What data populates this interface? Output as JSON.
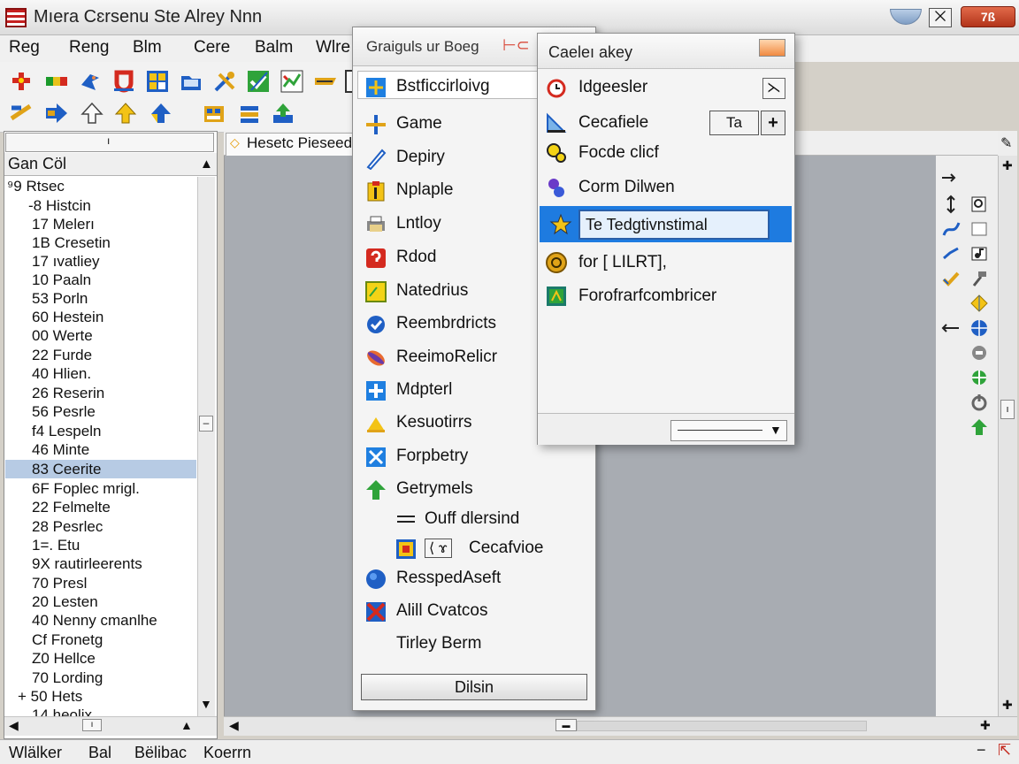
{
  "window": {
    "title": "Mıera Cɛrsenu Ste Alrey Nnn",
    "close_label": "7ß",
    "max_glyph": "⨉"
  },
  "menubar": [
    "Reg",
    "Reng",
    "Blm",
    "Cere",
    "Balm",
    "Wlre"
  ],
  "left_pane": {
    "top_mark": "ı",
    "header": "Gan Cöl",
    "root": "⁹9 Rtsec",
    "items": [
      "-8 Histcin",
      "17 Melerı",
      "1B Cresetin",
      "17 ıvatliey",
      "10 Paaln",
      "53 Porln",
      "60 Hestein",
      "00 Werte",
      "22 Furde",
      "40 Hlien.",
      "26 Reserin",
      "56 Pesrle",
      "f4 Lespeln",
      "46 Minte",
      "83 Ceerite",
      "6F Foplec mrigl.",
      "22 Felmelte",
      "28 Pesrlec",
      "1=. Etu",
      "9X rautirleerents",
      "70 Presl",
      "20 Lesten",
      "40 Nenny cmanlhe",
      "Cf Fronetg",
      "Z0 Hellce",
      "70 Lording",
      "+ 50 Hets",
      "14 heolix"
    ],
    "selected_index": 14
  },
  "document": {
    "tab_label": "Hesetc Pieseed"
  },
  "menu1": {
    "title": "Graiguls ur Boeg",
    "title_glyph": "⊢⊂",
    "highlight": "Bstficcirloivg",
    "items": [
      {
        "icon": "plus-cross-icon",
        "label": "Game"
      },
      {
        "icon": "pen-icon",
        "label": "Depiry"
      },
      {
        "icon": "clipboard-icon",
        "label": "Nplaple"
      },
      {
        "icon": "printer-icon",
        "label": "Lntloy"
      },
      {
        "icon": "red-question-icon",
        "label": "Rdod"
      },
      {
        "icon": "yellow-note-icon",
        "label": "Natedrius"
      },
      {
        "icon": "blue-shield-icon",
        "label": "Reembrdricts"
      },
      {
        "icon": "capsule-icon",
        "label": "ReeimoRelicr"
      },
      {
        "icon": "blue-plus-icon",
        "label": "Mdpterl"
      },
      {
        "icon": "yellow-triangle-icon",
        "label": "Kesuotirrs"
      },
      {
        "icon": "blue-cross-icon",
        "label": "Forpbetry"
      },
      {
        "icon": "green-arrow-up-icon",
        "label": "Getrymels"
      },
      {
        "icon": "equals-icon",
        "label": "Ouff dlersind"
      },
      {
        "icon": "color-square-icon",
        "label": "Cecafvioe",
        "prefix": "⟨ ɤ"
      },
      {
        "icon": "blue-circle-icon",
        "label": "ResspedAseft"
      },
      {
        "icon": "flag-icon",
        "label": "Alill Cvatcos"
      },
      {
        "icon": "none",
        "label": "Tirley Berm"
      }
    ],
    "button_label": "Dilsin"
  },
  "menu2": {
    "title": "Caeleı akey",
    "items": [
      {
        "icon": "alarm-icon",
        "label": "Idgeesler"
      },
      {
        "icon": "blue-ruler-icon",
        "label": "Cecafiele"
      },
      {
        "icon": "yellow-link-icon",
        "label": "Focde clicf"
      },
      {
        "icon": "purple-key-icon",
        "label": "Corm Dilwen"
      },
      {
        "icon": "gold-coin-icon",
        "label": "for [ LILRT],"
      },
      {
        "icon": "green-frame-icon",
        "label": "Forofrarfcombricer"
      }
    ],
    "spin_value": "Ta",
    "spin_plus": "+",
    "close_glyph": "⋋",
    "selected": "Te Tedgtivnstimal"
  },
  "statusbar": [
    "Wlälker",
    "Bal",
    "Bëlibac",
    "Koerrn"
  ],
  "colors": {
    "selection_blue": "#1e7be0",
    "tree_selection": "#b7cbe4",
    "workspace_gray": "#a8acb2"
  }
}
